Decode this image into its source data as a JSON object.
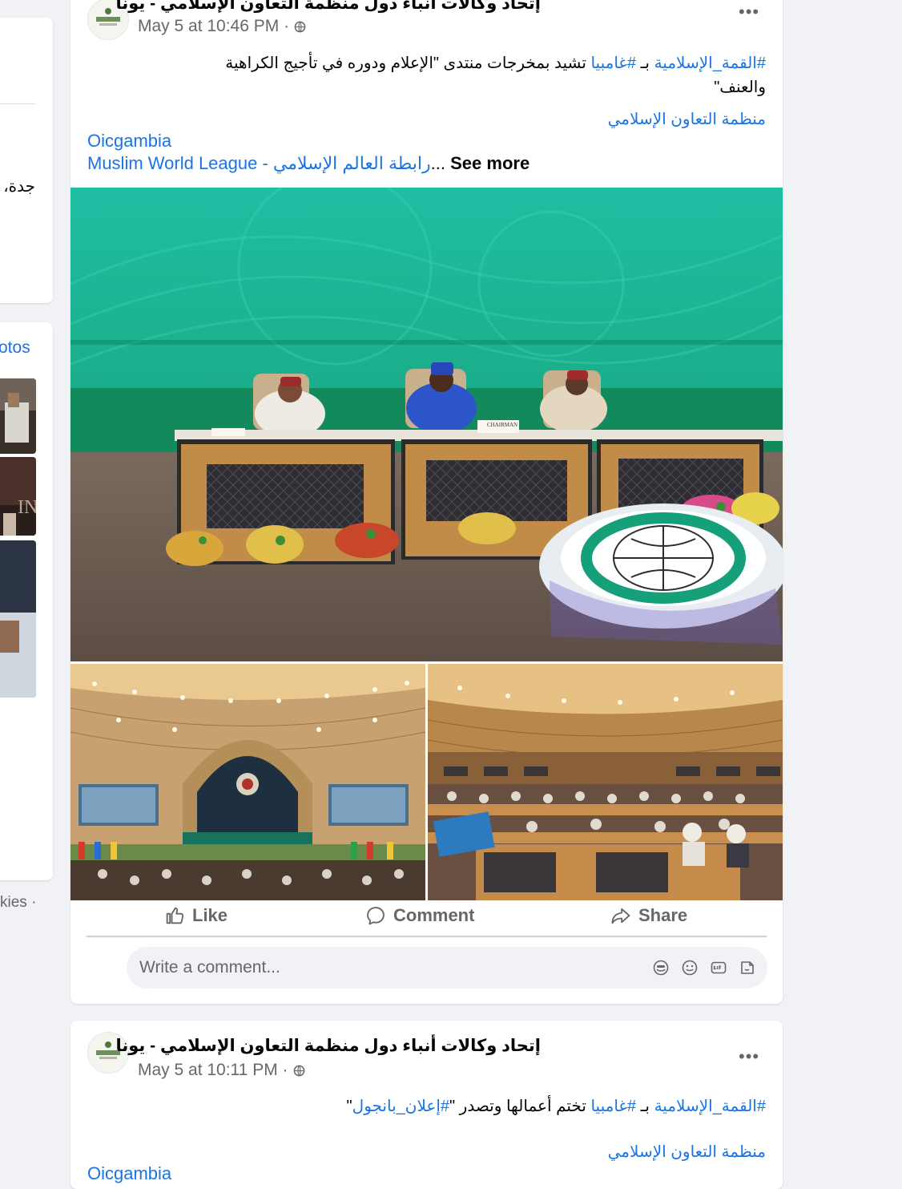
{
  "left_column": {
    "card1_text": "جدة،",
    "card2_label": "otos",
    "thumb_text": "IN",
    "footer_text": "kies ·"
  },
  "post1": {
    "page_name": "إتحاد وكالات أنباء دول منظمة التعاون الإسلامي - يونا",
    "timestamp": "May 5 at 10:46 PM ·",
    "line1_tag1": "#القمة_الإسلامية",
    "line1_mid": " بـ ",
    "line1_tag2": "#غامبيا",
    "line1_rest": " تشيد بمخرجات منتدى \"الإعلام ودوره في تأجيج الكراهية",
    "line2": "والعنف\"",
    "mention_arabic": "منظمة التعاون الإسلامي",
    "mention_oic": "Oicgambia",
    "mention_mwl": "Muslim World League - رابطة العالم الإسلامي",
    "ellipsis": "...",
    "see_more": "See more",
    "photo_label": "CHAIRMAN"
  },
  "actions": {
    "like": "Like",
    "comment": "Comment",
    "share": "Share"
  },
  "comment_box": {
    "placeholder": "Write a comment..."
  },
  "post2": {
    "page_name": "إتحاد وكالات أنباء دول منظمة التعاون الإسلامي - يونا",
    "timestamp": "May 5 at 10:11 PM ·",
    "line1_tag1": "#القمة_الإسلامية",
    "line1_mid": " بـ ",
    "line1_tag2": "#غامبيا",
    "line1_rest": " تختم أعمالها وتصدر \"",
    "line1_tag3": "#إعلان_بانجول",
    "line1_end": "\"",
    "mention_arabic": "منظمة التعاون الإسلامي",
    "mention_oic": "Oicgambia"
  },
  "colors": {
    "link": "#1b74e4",
    "secondary_text": "#65676b",
    "background": "#f0f2f5"
  }
}
